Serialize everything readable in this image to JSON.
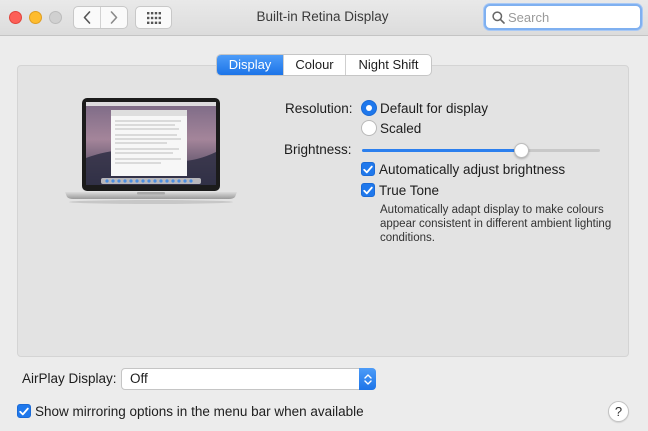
{
  "window": {
    "title": "Built-in Retina Display"
  },
  "toolbar": {
    "search_placeholder": "Search"
  },
  "tabs": [
    {
      "label": "Display",
      "active": true
    },
    {
      "label": "Colour",
      "active": false
    },
    {
      "label": "Night Shift",
      "active": false
    }
  ],
  "display": {
    "resolution_label": "Resolution:",
    "resolution_options": [
      {
        "label": "Default for display",
        "selected": true
      },
      {
        "label": "Scaled",
        "selected": false
      }
    ],
    "brightness_label": "Brightness:",
    "brightness_level": 0.68,
    "auto_brightness_label": "Automatically adjust brightness",
    "auto_brightness_checked": true,
    "true_tone_label": "True Tone",
    "true_tone_checked": true,
    "true_tone_description": "Automatically adapt display to make colours appear consistent in different ambient lighting conditions."
  },
  "airplay": {
    "label": "AirPlay Display:",
    "value": "Off"
  },
  "mirroring": {
    "label": "Show mirroring options in the menu bar when available",
    "checked": true
  },
  "help": {
    "label": "?"
  },
  "icons": [
    "back-arrow-icon",
    "forward-arrow-icon",
    "show-all-grid-icon",
    "search-icon",
    "checkmark-icon",
    "updown-chevron-icon",
    "laptop-icon"
  ],
  "colors": {
    "accent": "#1f78ec"
  }
}
